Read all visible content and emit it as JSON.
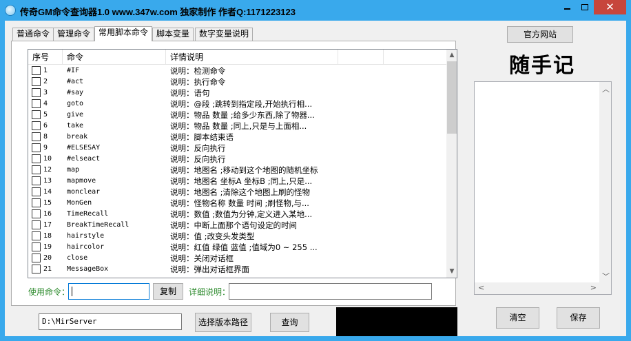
{
  "window": {
    "title": "传奇GM命令查询器1.0 www.347w.com 独家制作 作者Q:1171223123",
    "close_glyph": "✕"
  },
  "tabs": [
    {
      "label": "普通命令",
      "active": false
    },
    {
      "label": "管理命令",
      "active": false
    },
    {
      "label": "常用脚本命令",
      "active": true
    },
    {
      "label": "脚本变量",
      "active": false
    },
    {
      "label": "数字变量说明",
      "active": false
    }
  ],
  "list": {
    "columns": [
      "序号",
      "命令",
      "详情说明"
    ],
    "rows": [
      {
        "num": "1",
        "cmd": "#IF",
        "desc": "说明：检测命令"
      },
      {
        "num": "2",
        "cmd": "#act",
        "desc": "说明：执行命令"
      },
      {
        "num": "3",
        "cmd": "#say",
        "desc": "说明：语句"
      },
      {
        "num": "4",
        "cmd": "goto",
        "desc": "说明：@段 ;跳转到指定段,开始执行相..."
      },
      {
        "num": "5",
        "cmd": "give",
        "desc": "说明：物品 数量 ;给多少东西,除了物器..."
      },
      {
        "num": "6",
        "cmd": "take",
        "desc": "说明：物品 数量 ;同上,只是与上面相..."
      },
      {
        "num": "8",
        "cmd": "break",
        "desc": "说明：脚本结束语"
      },
      {
        "num": "9",
        "cmd": "#ELSESAY",
        "desc": "说明：反向执行"
      },
      {
        "num": "10",
        "cmd": "#elseact",
        "desc": "说明：反向执行"
      },
      {
        "num": "12",
        "cmd": "map",
        "desc": "说明：地图名 ;移动到这个地图的随机坐标"
      },
      {
        "num": "13",
        "cmd": "mapmove",
        "desc": "说明：地图名 坐标A 坐标B ;同上,只是..."
      },
      {
        "num": "14",
        "cmd": "monclear",
        "desc": "说明：地图名 ;清除这个地图上刷的怪物"
      },
      {
        "num": "15",
        "cmd": "MonGen",
        "desc": "说明：怪物名称 数量 时间 ;刷怪物,与..."
      },
      {
        "num": "16",
        "cmd": "TimeRecall",
        "desc": "说明：数值 ;数值为分钟,定义进入某地..."
      },
      {
        "num": "17",
        "cmd": "BreakTimeRecall",
        "desc": "说明：中断上面那个语句设定的时间"
      },
      {
        "num": "18",
        "cmd": "hairstyle",
        "desc": "说明：值 ;改变头发类型"
      },
      {
        "num": "19",
        "cmd": "haircolor",
        "desc": "说明：红值 绿值 蓝值 ;值域为0 ~ 255 ..."
      },
      {
        "num": "20",
        "cmd": "close",
        "desc": "说明：关闭对话框"
      },
      {
        "num": "21",
        "cmd": "MessageBox",
        "desc": "说明：弹出对话框界面"
      }
    ]
  },
  "command_bar": {
    "use_label": "使用命令：",
    "use_value": "",
    "copy_label": "复制",
    "detail_label": "详细说明：",
    "detail_value": ""
  },
  "bottom_bar": {
    "path_value": "D:\\MirServer",
    "choose_path_label": "选择版本路径",
    "query_label": "查询"
  },
  "right_panel": {
    "website_label": "官方网站",
    "note_title": "随手记",
    "clear_label": "清空",
    "save_label": "保存"
  }
}
